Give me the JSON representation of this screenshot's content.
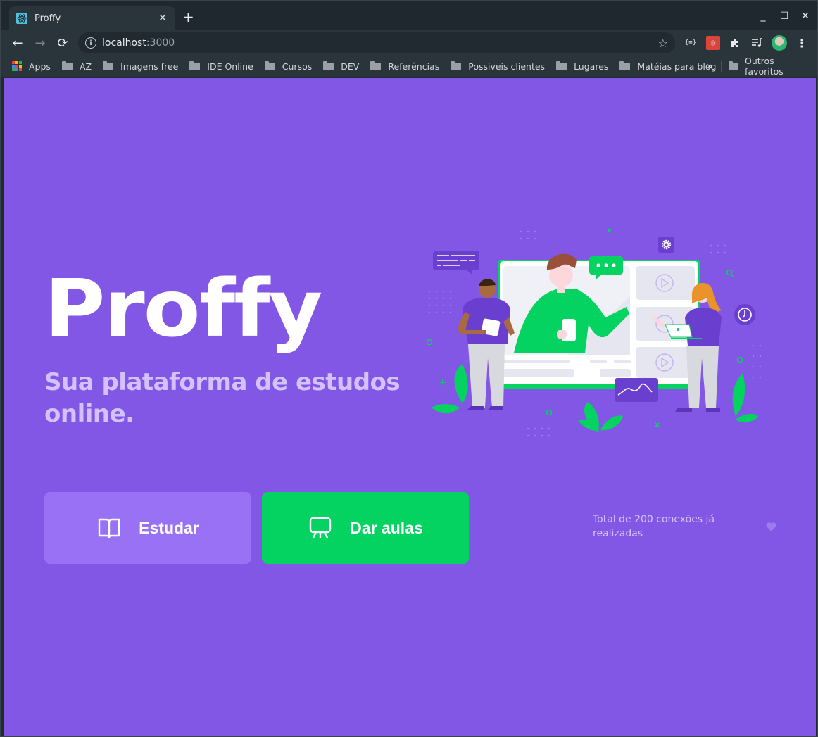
{
  "browser": {
    "tab": {
      "title": "Proffy",
      "favicon": "react-atom-icon"
    },
    "new_tab_label": "+",
    "window_controls": {
      "minimize": "_",
      "maximize": "☐",
      "close": "✕"
    },
    "toolbar": {
      "back": "←",
      "forward": "→",
      "reload": "⟳",
      "url_host": "localhost",
      "url_port": ":3000",
      "bookmark_star": "☆"
    },
    "extensions": [
      "json-viewer-icon",
      "react-devtools-icon",
      "extensions-puzzle-icon",
      "media-control-icon",
      "profile-avatar",
      "menu-kebab-icon"
    ],
    "bookmarks": [
      {
        "label": "Apps",
        "type": "apps"
      },
      {
        "label": "AZ",
        "type": "folder"
      },
      {
        "label": "Imagens free",
        "type": "folder"
      },
      {
        "label": "IDE Online",
        "type": "folder"
      },
      {
        "label": "Cursos",
        "type": "folder"
      },
      {
        "label": "DEV",
        "type": "folder"
      },
      {
        "label": "Referências",
        "type": "folder"
      },
      {
        "label": "Possiveis clientes",
        "type": "folder"
      },
      {
        "label": "Lugares",
        "type": "folder"
      },
      {
        "label": "Matéias para blog",
        "type": "folder"
      }
    ],
    "bookmarks_overflow": "»",
    "other_bookmarks": "Outros favoritos"
  },
  "page": {
    "logo": "Proffy",
    "tagline": "Sua plataforma de estudos online.",
    "buttons": {
      "study": {
        "label": "Estudar",
        "icon": "book-open-icon"
      },
      "teach": {
        "label": "Dar aulas",
        "icon": "presentation-easel-icon"
      }
    },
    "connections_text": "Total de 200 conexões já realizadas",
    "colors": {
      "background": "#8257e5",
      "primary_light": "#9871f5",
      "secondary": "#04d361",
      "text_in_primary": "#d4c2ff"
    }
  }
}
